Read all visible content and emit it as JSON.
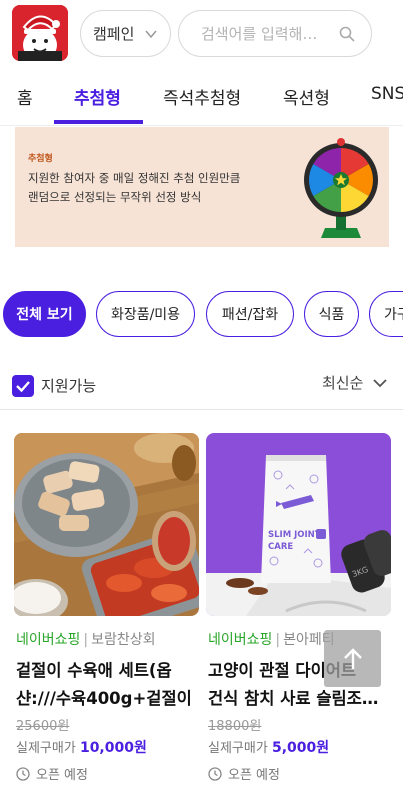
{
  "header": {
    "campaign_label": "캠페인",
    "search_placeholder": "검색어를 입력해주세요"
  },
  "tabs": [
    {
      "label": "홈",
      "active": false
    },
    {
      "label": "추첨형",
      "active": true
    },
    {
      "label": "즉석추첨형",
      "active": false
    },
    {
      "label": "옥션형",
      "active": false
    },
    {
      "label": "SNS",
      "active": false
    }
  ],
  "banner": {
    "tag": "추첨형",
    "line1": "지원한 참여자 중 매일 정해진 추첨 인원만큼",
    "line2": "랜덤으로 선정되는 무작위 선정 방식"
  },
  "categories": [
    {
      "label": "전체 보기",
      "active": true
    },
    {
      "label": "화장품/미용",
      "active": false
    },
    {
      "label": "패션/잡화",
      "active": false
    },
    {
      "label": "식품",
      "active": false
    },
    {
      "label": "가구",
      "active": false
    }
  ],
  "filter": {
    "available_label": "지원가능",
    "available_checked": true,
    "sort_label": "최신순"
  },
  "products": [
    {
      "platform": "네이버쇼핑",
      "store": "보람찬상회",
      "title_line1": "겉절이 수육애 세트(옵",
      "title_line2": "샨:///수육400g+겉절이",
      "original_price": "25600원",
      "price_label": "실제구매가",
      "price": "10,000원",
      "status": "오픈 예정"
    },
    {
      "platform": "네이버쇼핑",
      "store": "본아페티",
      "title_line1": "고양이 관절 다이어트",
      "title_line2": "건식 참치 사료 슬림조인트",
      "original_price": "18800원",
      "price_label": "실제구매가",
      "price": "5,000원",
      "status": "오픈 예정",
      "package_text_1": "SLIM JOINT",
      "package_text_2": "CARE",
      "dumbbell_text": "3KG"
    }
  ],
  "colors": {
    "accent": "#4a1fe0",
    "platform_green": "#2aa52a",
    "banner_bg": "#f6e3d6"
  }
}
